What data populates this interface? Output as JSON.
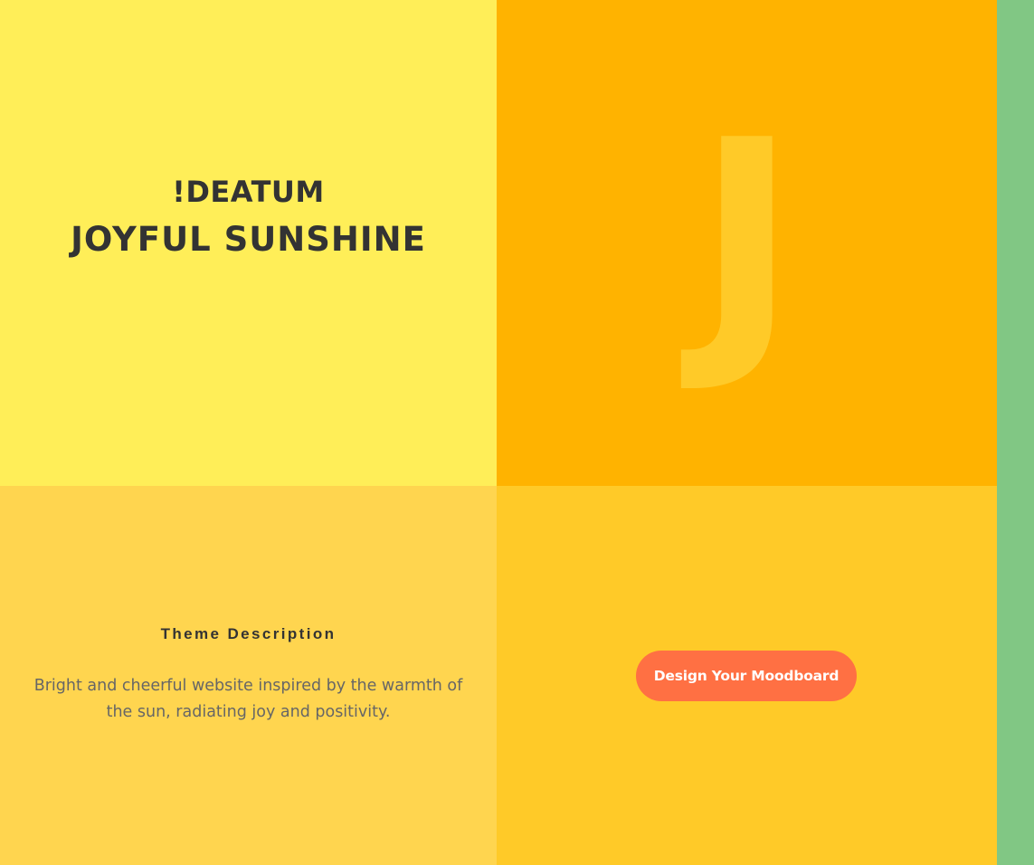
{
  "hero": {
    "brand": "!DEATUM",
    "theme_title": "JOYFUL SUNSHINE",
    "letter": "J"
  },
  "description": {
    "heading": "Theme Description",
    "text": "Bright and cheerful website inspired by the warmth of the sun, radiating joy and positivity."
  },
  "cta": {
    "label": "Design Your Moodboard"
  },
  "colors": {
    "title_panel": "#FFEE58",
    "letter_panel": "#FFB300",
    "letter": "#FFCA28",
    "description_panel": "#FFD54F",
    "cta_panel": "#FFCA28",
    "button": "#FF7043",
    "side_strip": "#81C784",
    "heading_text": "#333333",
    "body_text": "#666666"
  }
}
